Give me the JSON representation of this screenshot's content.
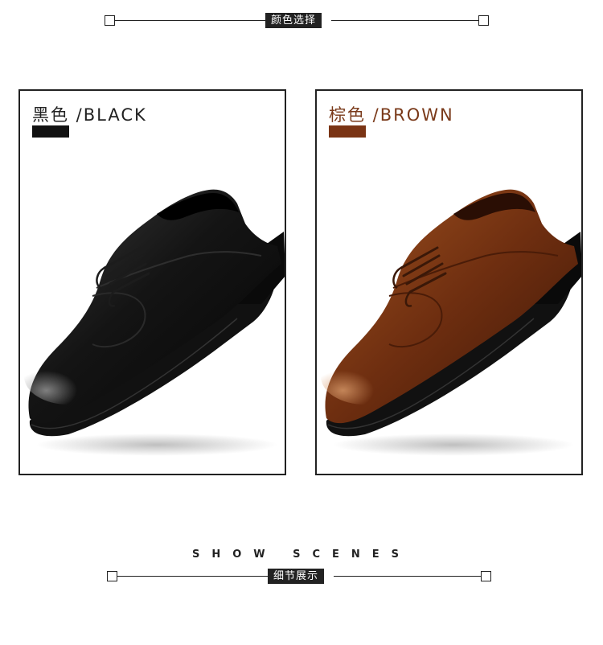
{
  "header_top": {
    "label": "颜色选择"
  },
  "panels": [
    {
      "label": "黑色 /BLACK",
      "label_color": "#222222",
      "swatch_color": "#111111",
      "shoe_color": "black"
    },
    {
      "label": "棕色 /BROWN",
      "label_color": "#7a3a1a",
      "swatch_color": "#7a3414",
      "shoe_color": "brown"
    }
  ],
  "scenes_title": "SHOW SCENES",
  "header_bottom": {
    "label": "细节展示"
  }
}
